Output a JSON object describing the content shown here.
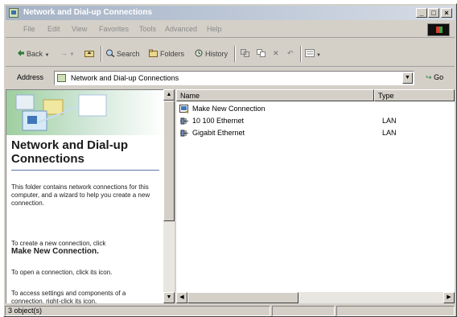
{
  "window": {
    "title": "Network and Dial-up Connections",
    "controls": {
      "minimize": "_",
      "maximize": "□",
      "close": "×"
    }
  },
  "menu": {
    "items": [
      "File",
      "Edit",
      "View",
      "Favorites",
      "Tools",
      "Advanced",
      "Help"
    ]
  },
  "toolbar": {
    "back": "Back",
    "forward": "→",
    "search": "Search",
    "folders": "Folders",
    "history": "History"
  },
  "address": {
    "label": "Address",
    "value": "Network and Dial-up Connections",
    "go": "Go"
  },
  "left_panel": {
    "title": "Network and Dial-up Connections",
    "description": "This folder contains network connections for this computer, and a wizard to help you create a new connection.",
    "create_intro": "To create a new connection, click",
    "create_link": "Make New Connection.",
    "open_text": "To open a connection, click its icon.",
    "access_text": "To access settings and components of a connection, right-click its icon."
  },
  "list": {
    "columns": [
      "Name",
      "Type"
    ],
    "rows": [
      {
        "name": "Make New Connection",
        "type": "",
        "icon": "wizard-icon"
      },
      {
        "name": "10 100 Ethernet",
        "type": "LAN",
        "icon": "lan-connection-icon"
      },
      {
        "name": "Gigabit Ethernet",
        "type": "LAN",
        "icon": "lan-connection-icon"
      }
    ]
  },
  "status": {
    "objects": "3 object(s)"
  }
}
